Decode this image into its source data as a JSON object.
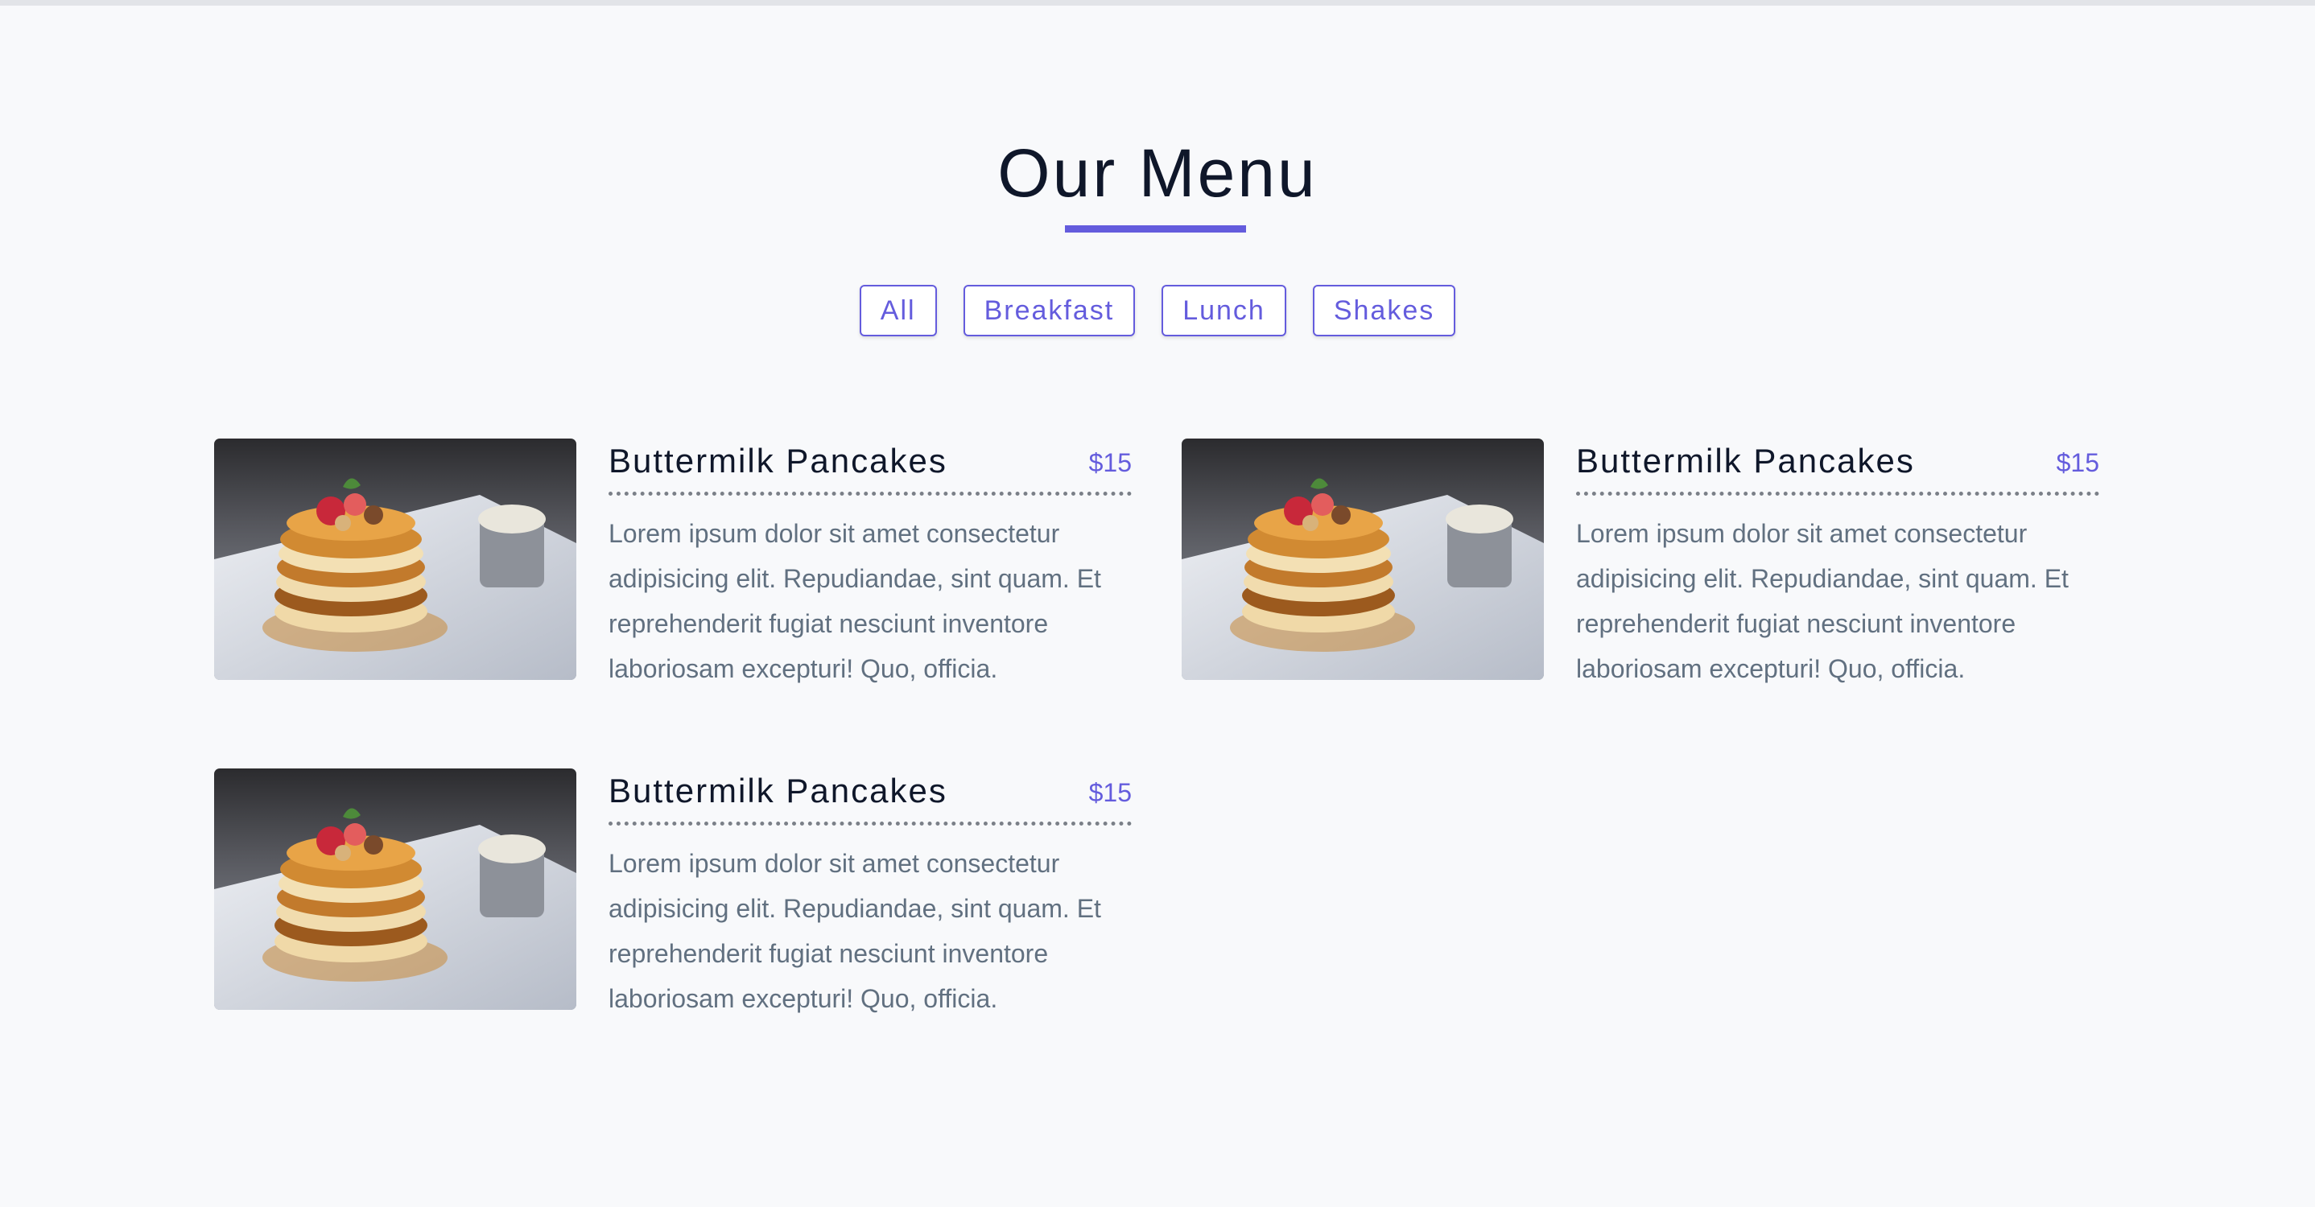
{
  "menu": {
    "title": "Our Menu",
    "filters": [
      "All",
      "Breakfast",
      "Lunch",
      "Shakes"
    ],
    "items": [
      {
        "name": "Buttermilk Pancakes",
        "price": "$15",
        "description": "Lorem ipsum dolor sit amet consectetur adipisicing elit. Repudiandae, sint quam. Et reprehenderit fugiat nesciunt inventore laboriosam excepturi! Quo, officia."
      },
      {
        "name": "Buttermilk Pancakes",
        "price": "$15",
        "description": "Lorem ipsum dolor sit amet consectetur adipisicing elit. Repudiandae, sint quam. Et reprehenderit fugiat nesciunt inventore laboriosam excepturi! Quo, officia."
      },
      {
        "name": "Buttermilk Pancakes",
        "price": "$15",
        "description": "Lorem ipsum dolor sit amet consectetur adipisicing elit. Repudiandae, sint quam. Et reprehenderit fugiat nesciunt inventore laboriosam excepturi! Quo, officia."
      }
    ]
  },
  "colors": {
    "accent": "#645cdd",
    "heading": "#0f172a",
    "body_text": "#617080",
    "background": "#f8f9fb"
  }
}
